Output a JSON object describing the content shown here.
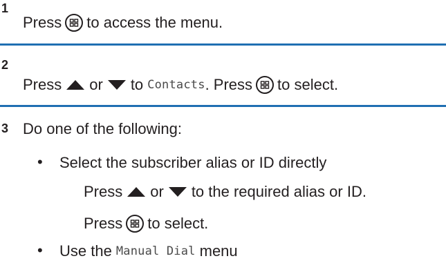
{
  "colors": {
    "separator": "#1f6fb2",
    "text": "#231f20"
  },
  "step1": {
    "number": "1",
    "press": "Press",
    "rest": "to access the menu.",
    "icon": "menu-ok-button-icon"
  },
  "step2": {
    "number": "2",
    "press": "Press",
    "or": "or",
    "to": "to",
    "target": "Contacts",
    "period": ".",
    "press2": "Press",
    "select": "to select.",
    "icons": [
      "up-arrow-icon",
      "down-arrow-icon",
      "menu-ok-button-icon"
    ]
  },
  "step3": {
    "number": "3",
    "intro": "Do one of the following:",
    "bullet1": "Select the subscriber alias or ID directly",
    "sub_press": "Press",
    "sub_or": "or",
    "sub_rest": "to the required alias or ID.",
    "sub_press2": "Press",
    "sub_select": "to select.",
    "bullet2_pre": "Use the",
    "bullet2_mono": "Manual Dial",
    "bullet2_post": "menu"
  }
}
